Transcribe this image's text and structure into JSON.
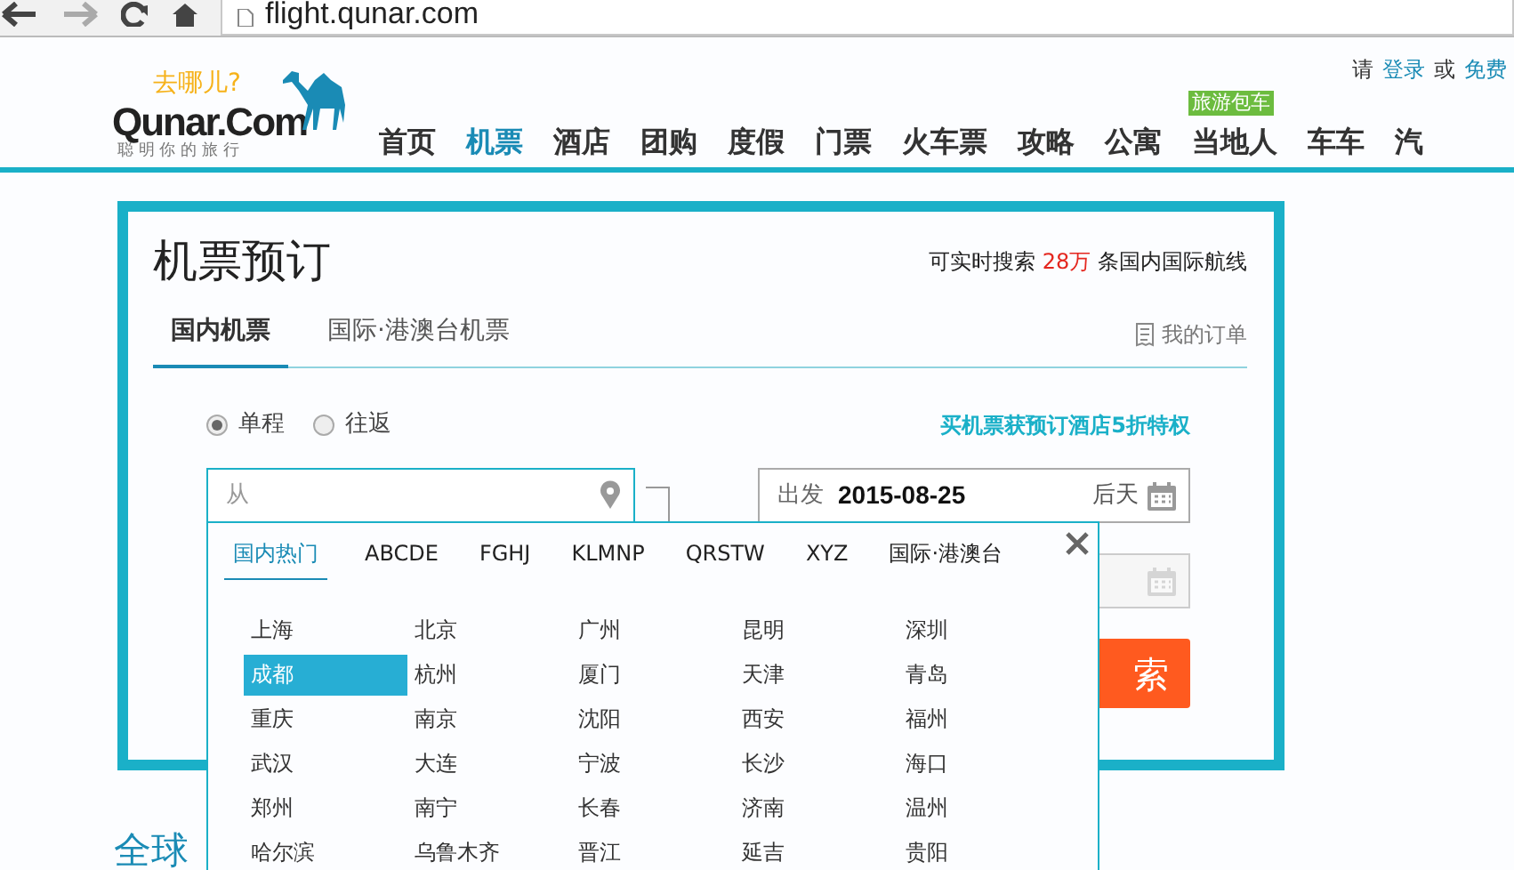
{
  "browser": {
    "address": "flight.qunar.com"
  },
  "header": {
    "logo": {
      "tagline": "去哪儿?",
      "wordmark": "Qunar.Com",
      "slogan": "聪 明 你 的 旅 行"
    },
    "account": [
      {
        "kind": "text",
        "label": "请"
      },
      {
        "kind": "link",
        "label": "登录"
      },
      {
        "kind": "text",
        "label": "或"
      },
      {
        "kind": "link",
        "label": "免费"
      }
    ],
    "nav": [
      {
        "label": "首页",
        "selected": false
      },
      {
        "label": "机票",
        "selected": true
      },
      {
        "label": "酒店",
        "selected": false
      },
      {
        "label": "团购",
        "selected": false
      },
      {
        "label": "度假",
        "selected": false
      },
      {
        "label": "门票",
        "selected": false
      },
      {
        "label": "火车票",
        "selected": false
      },
      {
        "label": "攻略",
        "selected": false
      },
      {
        "label": "公寓",
        "selected": false
      },
      {
        "label": "当地人",
        "selected": false,
        "badge": "旅游包车"
      },
      {
        "label": "车车",
        "selected": false
      },
      {
        "label": "汽",
        "selected": false
      }
    ]
  },
  "booking": {
    "title": "机票预订",
    "stats": {
      "prefix": "可实时搜索",
      "count": "28万",
      "suffix": "条国内国际航线"
    },
    "tabs": [
      {
        "label": "国内机票",
        "selected": true
      },
      {
        "label": "国际·港澳台机票",
        "selected": false
      }
    ],
    "my_orders": "我的订单",
    "trip_types": [
      {
        "label": "单程",
        "selected": true
      },
      {
        "label": "往返",
        "selected": false
      }
    ],
    "promo": "买机票获预订酒店5折特权",
    "from_field": {
      "placeholder": "从"
    },
    "depart_field": {
      "label": "出发",
      "value": "2015-08-25",
      "day": "后天"
    },
    "return_field": {
      "disabled": true
    },
    "search_button": {
      "label": "索"
    }
  },
  "city_picker": {
    "tabs": [
      {
        "label": "国内热门",
        "selected": true
      },
      {
        "label": "ABCDE",
        "selected": false
      },
      {
        "label": "FGHJ",
        "selected": false
      },
      {
        "label": "KLMNP",
        "selected": false
      },
      {
        "label": "QRSTW",
        "selected": false
      },
      {
        "label": "XYZ",
        "selected": false
      },
      {
        "label": "国际·港澳台",
        "selected": false
      }
    ],
    "cities": [
      {
        "name": "上海",
        "selected": false
      },
      {
        "name": "北京",
        "selected": false
      },
      {
        "name": "广州",
        "selected": false
      },
      {
        "name": "昆明",
        "selected": false
      },
      {
        "name": "深圳",
        "selected": false
      },
      {
        "name": "成都",
        "selected": true
      },
      {
        "name": "杭州",
        "selected": false
      },
      {
        "name": "厦门",
        "selected": false
      },
      {
        "name": "天津",
        "selected": false
      },
      {
        "name": "青岛",
        "selected": false
      },
      {
        "name": "重庆",
        "selected": false
      },
      {
        "name": "南京",
        "selected": false
      },
      {
        "name": "沈阳",
        "selected": false
      },
      {
        "name": "西安",
        "selected": false
      },
      {
        "name": "福州",
        "selected": false
      },
      {
        "name": "武汉",
        "selected": false
      },
      {
        "name": "大连",
        "selected": false
      },
      {
        "name": "宁波",
        "selected": false
      },
      {
        "name": "长沙",
        "selected": false
      },
      {
        "name": "海口",
        "selected": false
      },
      {
        "name": "郑州",
        "selected": false
      },
      {
        "name": "南宁",
        "selected": false
      },
      {
        "name": "长春",
        "selected": false
      },
      {
        "name": "济南",
        "selected": false
      },
      {
        "name": "温州",
        "selected": false
      },
      {
        "name": "哈尔滨",
        "selected": false
      },
      {
        "name": "乌鲁木齐",
        "selected": false
      },
      {
        "name": "晋江",
        "selected": false
      },
      {
        "name": "延吉",
        "selected": false
      },
      {
        "name": "贵阳",
        "selected": false
      }
    ]
  },
  "section_heading": "全球"
}
